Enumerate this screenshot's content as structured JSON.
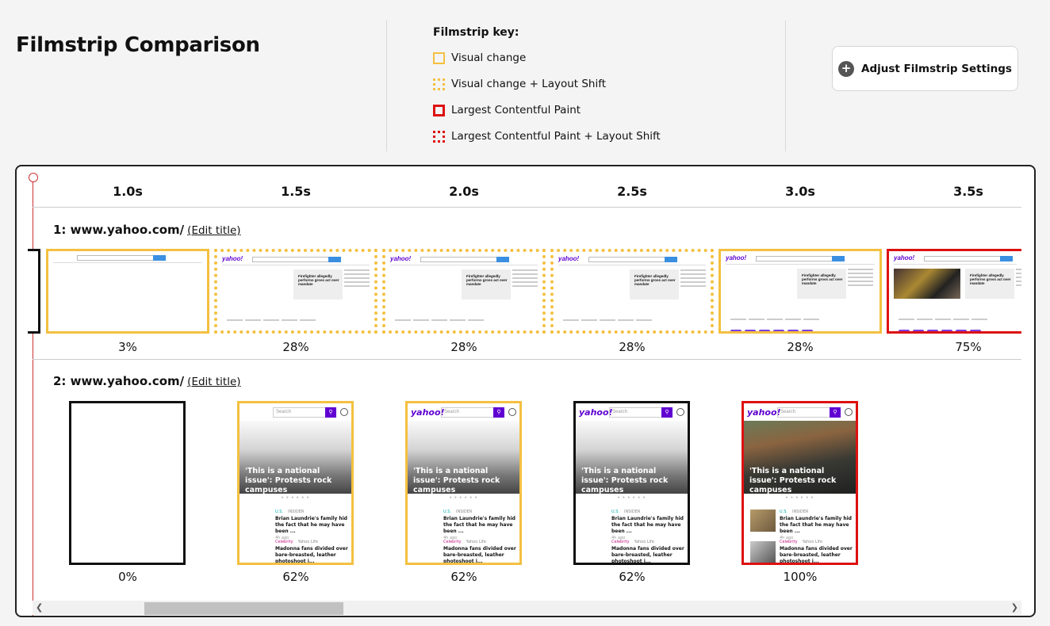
{
  "title": "Filmstrip Comparison",
  "key": {
    "title": "Filmstrip key:",
    "items": [
      {
        "label": "Visual change"
      },
      {
        "label": "Visual change + Layout Shift"
      },
      {
        "label": "Largest Contentful Paint"
      },
      {
        "label": "Largest Contentful Paint + Layout Shift"
      }
    ]
  },
  "adjust_button": {
    "icon": "plus-icon",
    "label": "Adjust Filmstrip Settings"
  },
  "timeline": {
    "ticks": [
      "1.0s",
      "1.5s",
      "2.0s",
      "2.5s",
      "3.0s",
      "3.5s"
    ]
  },
  "rows": [
    {
      "label": "1: www.yahoo.com/",
      "edit": "(Edit title)",
      "frames": [
        {
          "pct": "3%"
        },
        {
          "pct": "28%",
          "logo": "yahoo!",
          "headline": "Firefighter allegedly performs gross act over mandate"
        },
        {
          "pct": "28%",
          "logo": "yahoo!",
          "headline": "Firefighter allegedly performs gross act over mandate"
        },
        {
          "pct": "28%",
          "logo": "yahoo!",
          "headline": "Firefighter allegedly performs gross act over mandate"
        },
        {
          "pct": "28%",
          "logo": "yahoo!",
          "headline": "Firefighter allegedly performs gross act over mandate"
        },
        {
          "pct": "75%",
          "logo": "yahoo!",
          "headline": "Firefighter allegedly performs gross act over mandate"
        }
      ]
    },
    {
      "label": "2: www.yahoo.com/",
      "edit": "(Edit title)",
      "frames": [
        {
          "pct": "0%"
        },
        {
          "pct": "62%"
        },
        {
          "pct": "62%"
        },
        {
          "pct": "62%"
        },
        {
          "pct": "100%"
        }
      ]
    }
  ],
  "mobile": {
    "logo": "yahoo!",
    "search_placeholder": "Search",
    "hero_title": "'This is a national issue': Protests rock campuses",
    "article1": {
      "cat": "U.S.",
      "src": "INSIDER",
      "title": "Brian Laundrie's family hid the fact that he may have been ...",
      "ago": "4h ago"
    },
    "article2": {
      "cat": "Celebrity",
      "src": "Yahoo Life",
      "title": "Madonna fans divided over bare-breasted, leather photoshoot i..."
    }
  },
  "colors": {
    "visual_change": "#f4c040",
    "lcp": "#dd1111",
    "yahoo_purple": "#6001d2"
  }
}
